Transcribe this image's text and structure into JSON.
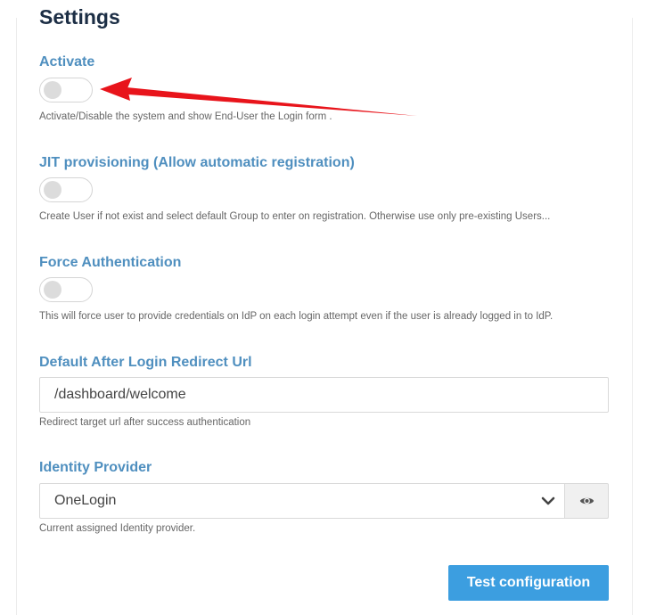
{
  "page": {
    "title": "Settings"
  },
  "settings": {
    "activate": {
      "label": "Activate",
      "enabled": false,
      "help": "Activate/Disable the system and show End-User the Login form ."
    },
    "jit": {
      "label": "JIT provisioning (Allow automatic registration)",
      "enabled": false,
      "help": "Create User if not exist and select default Group to enter on registration. Otherwise use only pre-existing Users..."
    },
    "force_auth": {
      "label": "Force Authentication",
      "enabled": false,
      "help": "This will force user to provide credentials on IdP on each login attempt even if the user is already logged in to IdP."
    },
    "redirect": {
      "label": "Default After Login Redirect Url",
      "value": "/dashboard/welcome",
      "help": "Redirect target url after success authentication"
    },
    "idp": {
      "label": "Identity Provider",
      "selected": "OneLogin",
      "help": "Current assigned Identity provider.",
      "view_icon": "eye-icon"
    }
  },
  "actions": {
    "test_label": "Test configuration"
  },
  "annotation": {
    "color": "#e8141b",
    "icon": "red-arrow"
  },
  "colors": {
    "title": "#1c2e45",
    "label": "#4f8fbf",
    "button": "#3c9ee0"
  }
}
